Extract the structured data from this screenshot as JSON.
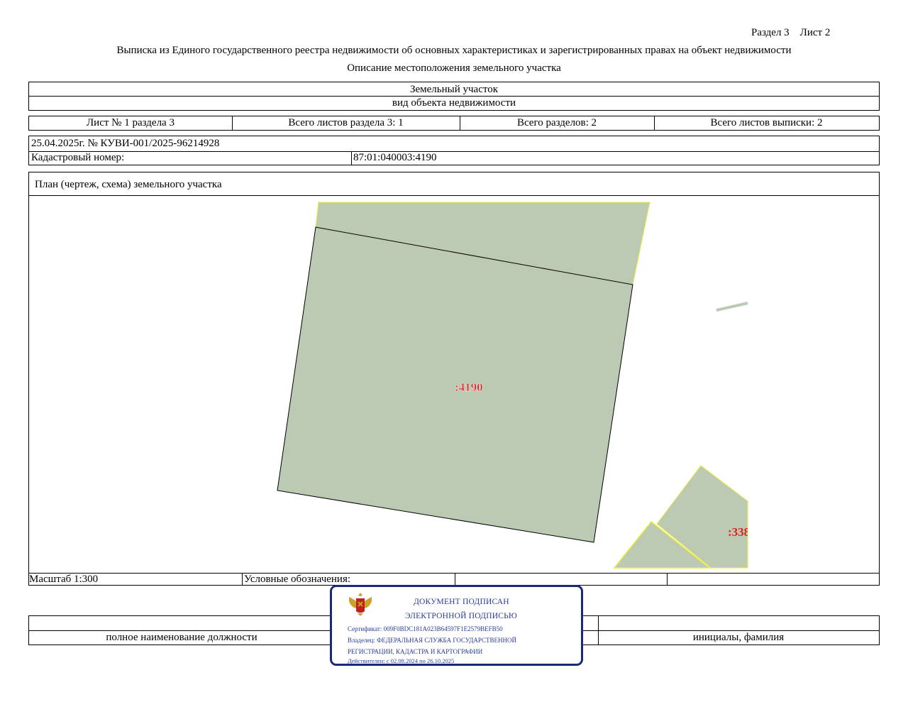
{
  "header": {
    "section_sheet": "Раздел 3    Лист 2",
    "title": "Выписка из Единого государственного реестра недвижимости об основных характеристиках и зарегистрированных правах на объект недвижимости",
    "subtitle": "Описание местоположения земельного участка"
  },
  "object": {
    "type": "Земельный участок",
    "type_caption": "вид объекта недвижимости"
  },
  "sheets": {
    "sheet": "Лист № 1 раздела 3",
    "total_section_sheets": "Всего листов раздела 3: 1",
    "total_sections": "Всего разделов: 2",
    "total_extract_sheets": "Всего листов выписки: 2"
  },
  "record": {
    "date_number": "25.04.2025г. № КУВИ-001/2025-96214928",
    "cadastral_label": "Кадастровый номер:",
    "cadastral_value": "87:01:040003:4190"
  },
  "plan": {
    "title": "План (чертеж, схема) земельного участка",
    "parcel_label": ":4190",
    "neighbor_label": ":338",
    "fill_color": "#bccab4",
    "border_color": "#e8ec3c",
    "label_color": "#e02020"
  },
  "footer": {
    "scale": "Масштаб 1:300",
    "legend": "Условные обозначения:",
    "position_caption": "полное наименование должности",
    "name_caption": "инициалы, фамилия"
  },
  "stamp": {
    "line1": "ДОКУМЕНТ ПОДПИСАН",
    "line2": "ЭЛЕКТРОННОЙ ПОДПИСЬЮ",
    "certificate": "Сертификат: 009F0BDC181A023B64597F1E2579BEFB50",
    "owner_1": "Владелец: ФЕДЕРАЛЬНАЯ СЛУЖБА ГОСУДАРСТВЕННОЙ",
    "owner_2": "РЕГИСТРАЦИИ, КАДАСТРА И КАРТОГРАФИИ",
    "valid": "Действителен: с 02.08.2024 по 26.10.2025",
    "color": "#1a2a7a",
    "emblem_icon": "double-headed-eagle-emblem-icon"
  }
}
